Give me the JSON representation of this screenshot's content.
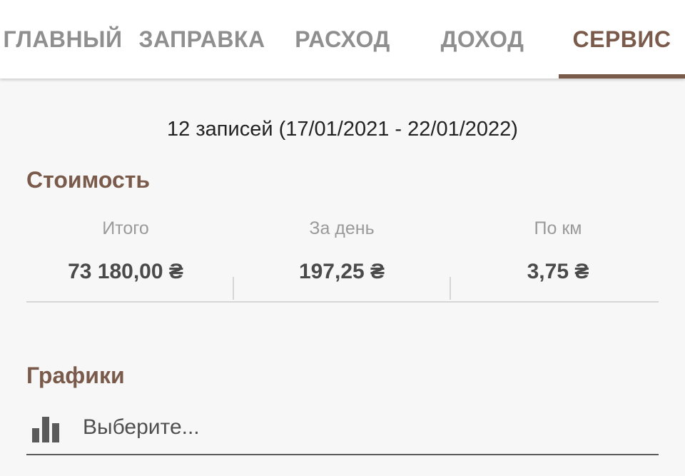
{
  "tabs": [
    {
      "label": "ГЛАВНЫЙ"
    },
    {
      "label": "ЗАПРАВКА"
    },
    {
      "label": "РАСХОД"
    },
    {
      "label": "ДОХОД"
    },
    {
      "label": "СЕРВИС"
    }
  ],
  "active_tab": "СЕРВИС",
  "colors": {
    "accent": "#7a5a4a",
    "tab_inactive": "#8f8f8f",
    "background": "#f7f7f7"
  },
  "summary": {
    "records_text": "12 записей (17/01/2021 - 22/01/2022)"
  },
  "cost": {
    "title": "Стоимость",
    "stats": [
      {
        "label": "Итого",
        "value": "73 180,00 ₴"
      },
      {
        "label": "За день",
        "value": "197,25 ₴"
      },
      {
        "label": "По км",
        "value": "3,75 ₴"
      }
    ]
  },
  "charts": {
    "title": "Графики",
    "select_placeholder": "Выберите...",
    "icon": "bar-chart-icon"
  }
}
